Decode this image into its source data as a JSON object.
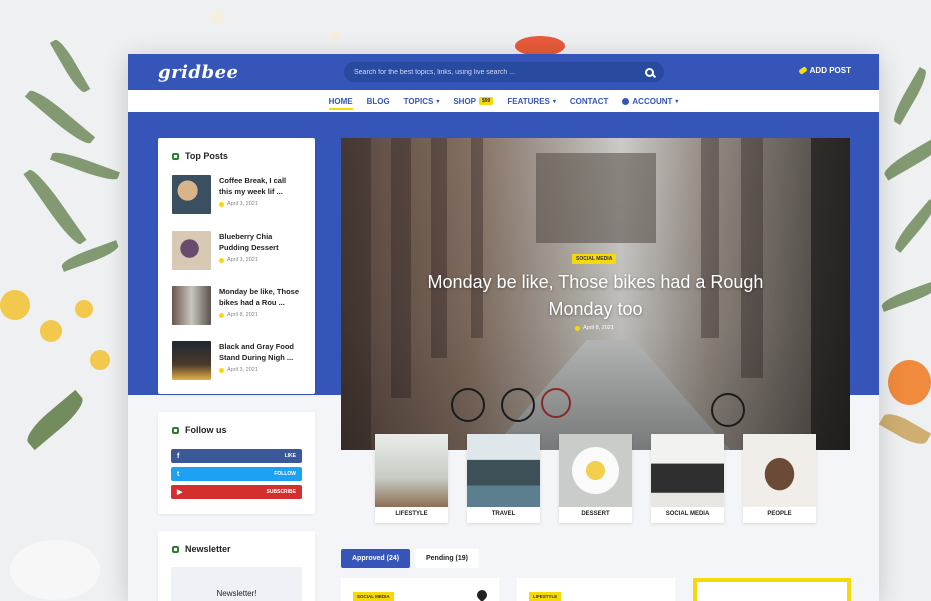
{
  "header": {
    "logo": "gridbee",
    "search_placeholder": "Search for the best topics, links, using live search ...",
    "add_post": "ADD POST"
  },
  "nav": {
    "items": [
      {
        "label": "HOME",
        "active": true
      },
      {
        "label": "BLOG"
      },
      {
        "label": "TOPICS",
        "dropdown": true
      },
      {
        "label": "SHOP",
        "badge": "$99"
      },
      {
        "label": "FEATURES",
        "dropdown": true
      },
      {
        "label": "CONTACT"
      },
      {
        "label": "ACCOUNT",
        "dropdown": true,
        "icon": "user-icon"
      }
    ]
  },
  "sidebar": {
    "top_posts": {
      "title": "Top Posts",
      "posts": [
        {
          "title": "Coffee Break, I call this my week lif ...",
          "date": "April 3, 2021"
        },
        {
          "title": "Blueberry Chia Pudding Dessert",
          "date": "April 3, 2021"
        },
        {
          "title": "Monday be like, Those bikes had a Rou ...",
          "date": "April 8, 2021"
        },
        {
          "title": "Black and Gray Food Stand During Nigh ...",
          "date": "April 3, 2021"
        }
      ]
    },
    "follow": {
      "title": "Follow us",
      "buttons": [
        {
          "icon": "f",
          "label": "LIKE",
          "color": "#3b5998"
        },
        {
          "icon": "t",
          "label": "FOLLOW",
          "color": "#1da1f2"
        },
        {
          "icon": "▶",
          "label": "SUBSCRIBE",
          "color": "#d32f2f"
        }
      ]
    },
    "newsletter": {
      "title": "Newsletter",
      "box_text": "Newsletter!"
    }
  },
  "hero": {
    "category": "SOCIAL MEDIA",
    "title": "Monday be like, Those bikes had a Rough Monday too",
    "date": "April 8, 2021"
  },
  "categories": [
    "LIFESTYLE",
    "TRAVEL",
    "DESSERT",
    "SOCIAL MEDIA",
    "PEOPLE"
  ],
  "tabs": {
    "approved": "Approved (24)",
    "pending": "Pending (19)"
  },
  "cards": [
    {
      "badge": "SOCIAL MEDIA"
    },
    {
      "badge": "LIFESTYLE"
    }
  ],
  "colors": {
    "brand_blue": "#3556b8",
    "accent_yellow": "#f5d90a"
  }
}
